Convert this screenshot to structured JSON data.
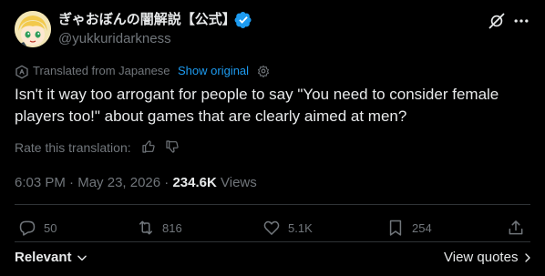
{
  "author": {
    "display_name": "ぎゃおぼんの闇解説【公式】",
    "handle": "@yukkuridarkness",
    "verified": true
  },
  "translation": {
    "label": "Translated from Japanese",
    "show_original": "Show original"
  },
  "tweet": {
    "text": "Isn't it way too arrogant for people to say \"You need to consider female players too!\" about games that are clearly aimed at men?"
  },
  "rating": {
    "label": "Rate this translation:"
  },
  "meta": {
    "time": "6:03 PM",
    "date": "May 23, 2026",
    "views_count": "234.6K",
    "views_label": "Views",
    "separator": "·"
  },
  "actions": {
    "replies": "50",
    "reposts": "816",
    "likes": "5.1K",
    "bookmarks": "254"
  },
  "footer": {
    "sort_label": "Relevant",
    "view_quotes": "View quotes"
  },
  "colors": {
    "background": "#000000",
    "text": "#e7e9ea",
    "muted": "#71767b",
    "accent": "#1d9bf0",
    "divider": "#2f3336"
  },
  "icons": [
    "avatar-image",
    "verified-badge-icon",
    "grok-icon",
    "more-icon",
    "translate-icon",
    "settings-icon",
    "thumbs-up-icon",
    "thumbs-down-icon",
    "reply-icon",
    "repost-icon",
    "like-icon",
    "bookmark-icon",
    "share-icon",
    "chevron-down-icon",
    "chevron-right-icon"
  ]
}
